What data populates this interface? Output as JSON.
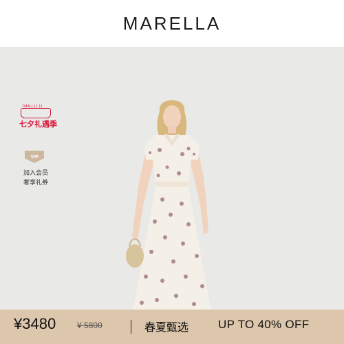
{
  "header": {
    "brand": "MARELLA"
  },
  "promo": {
    "small_text": "TMALL11.11",
    "main_text": "七夕礼遇季"
  },
  "membership": {
    "badge": "VIP",
    "line1": "加入会员",
    "line2": "奢享礼券"
  },
  "product": {
    "image": "model-in-seashell-print-shirt-dress"
  },
  "price_bar": {
    "price": "¥3480",
    "original_price": "¥ 5800",
    "title": "春夏甄选",
    "offer": "UP TO 40% OFF"
  },
  "colors": {
    "brand_text": "#1a1a1a",
    "stage_bg": "#e9e9e7",
    "promo_red": "#d8193b",
    "vip_gold": "#cdb89e",
    "bar_bg": "#dcc6ac"
  }
}
